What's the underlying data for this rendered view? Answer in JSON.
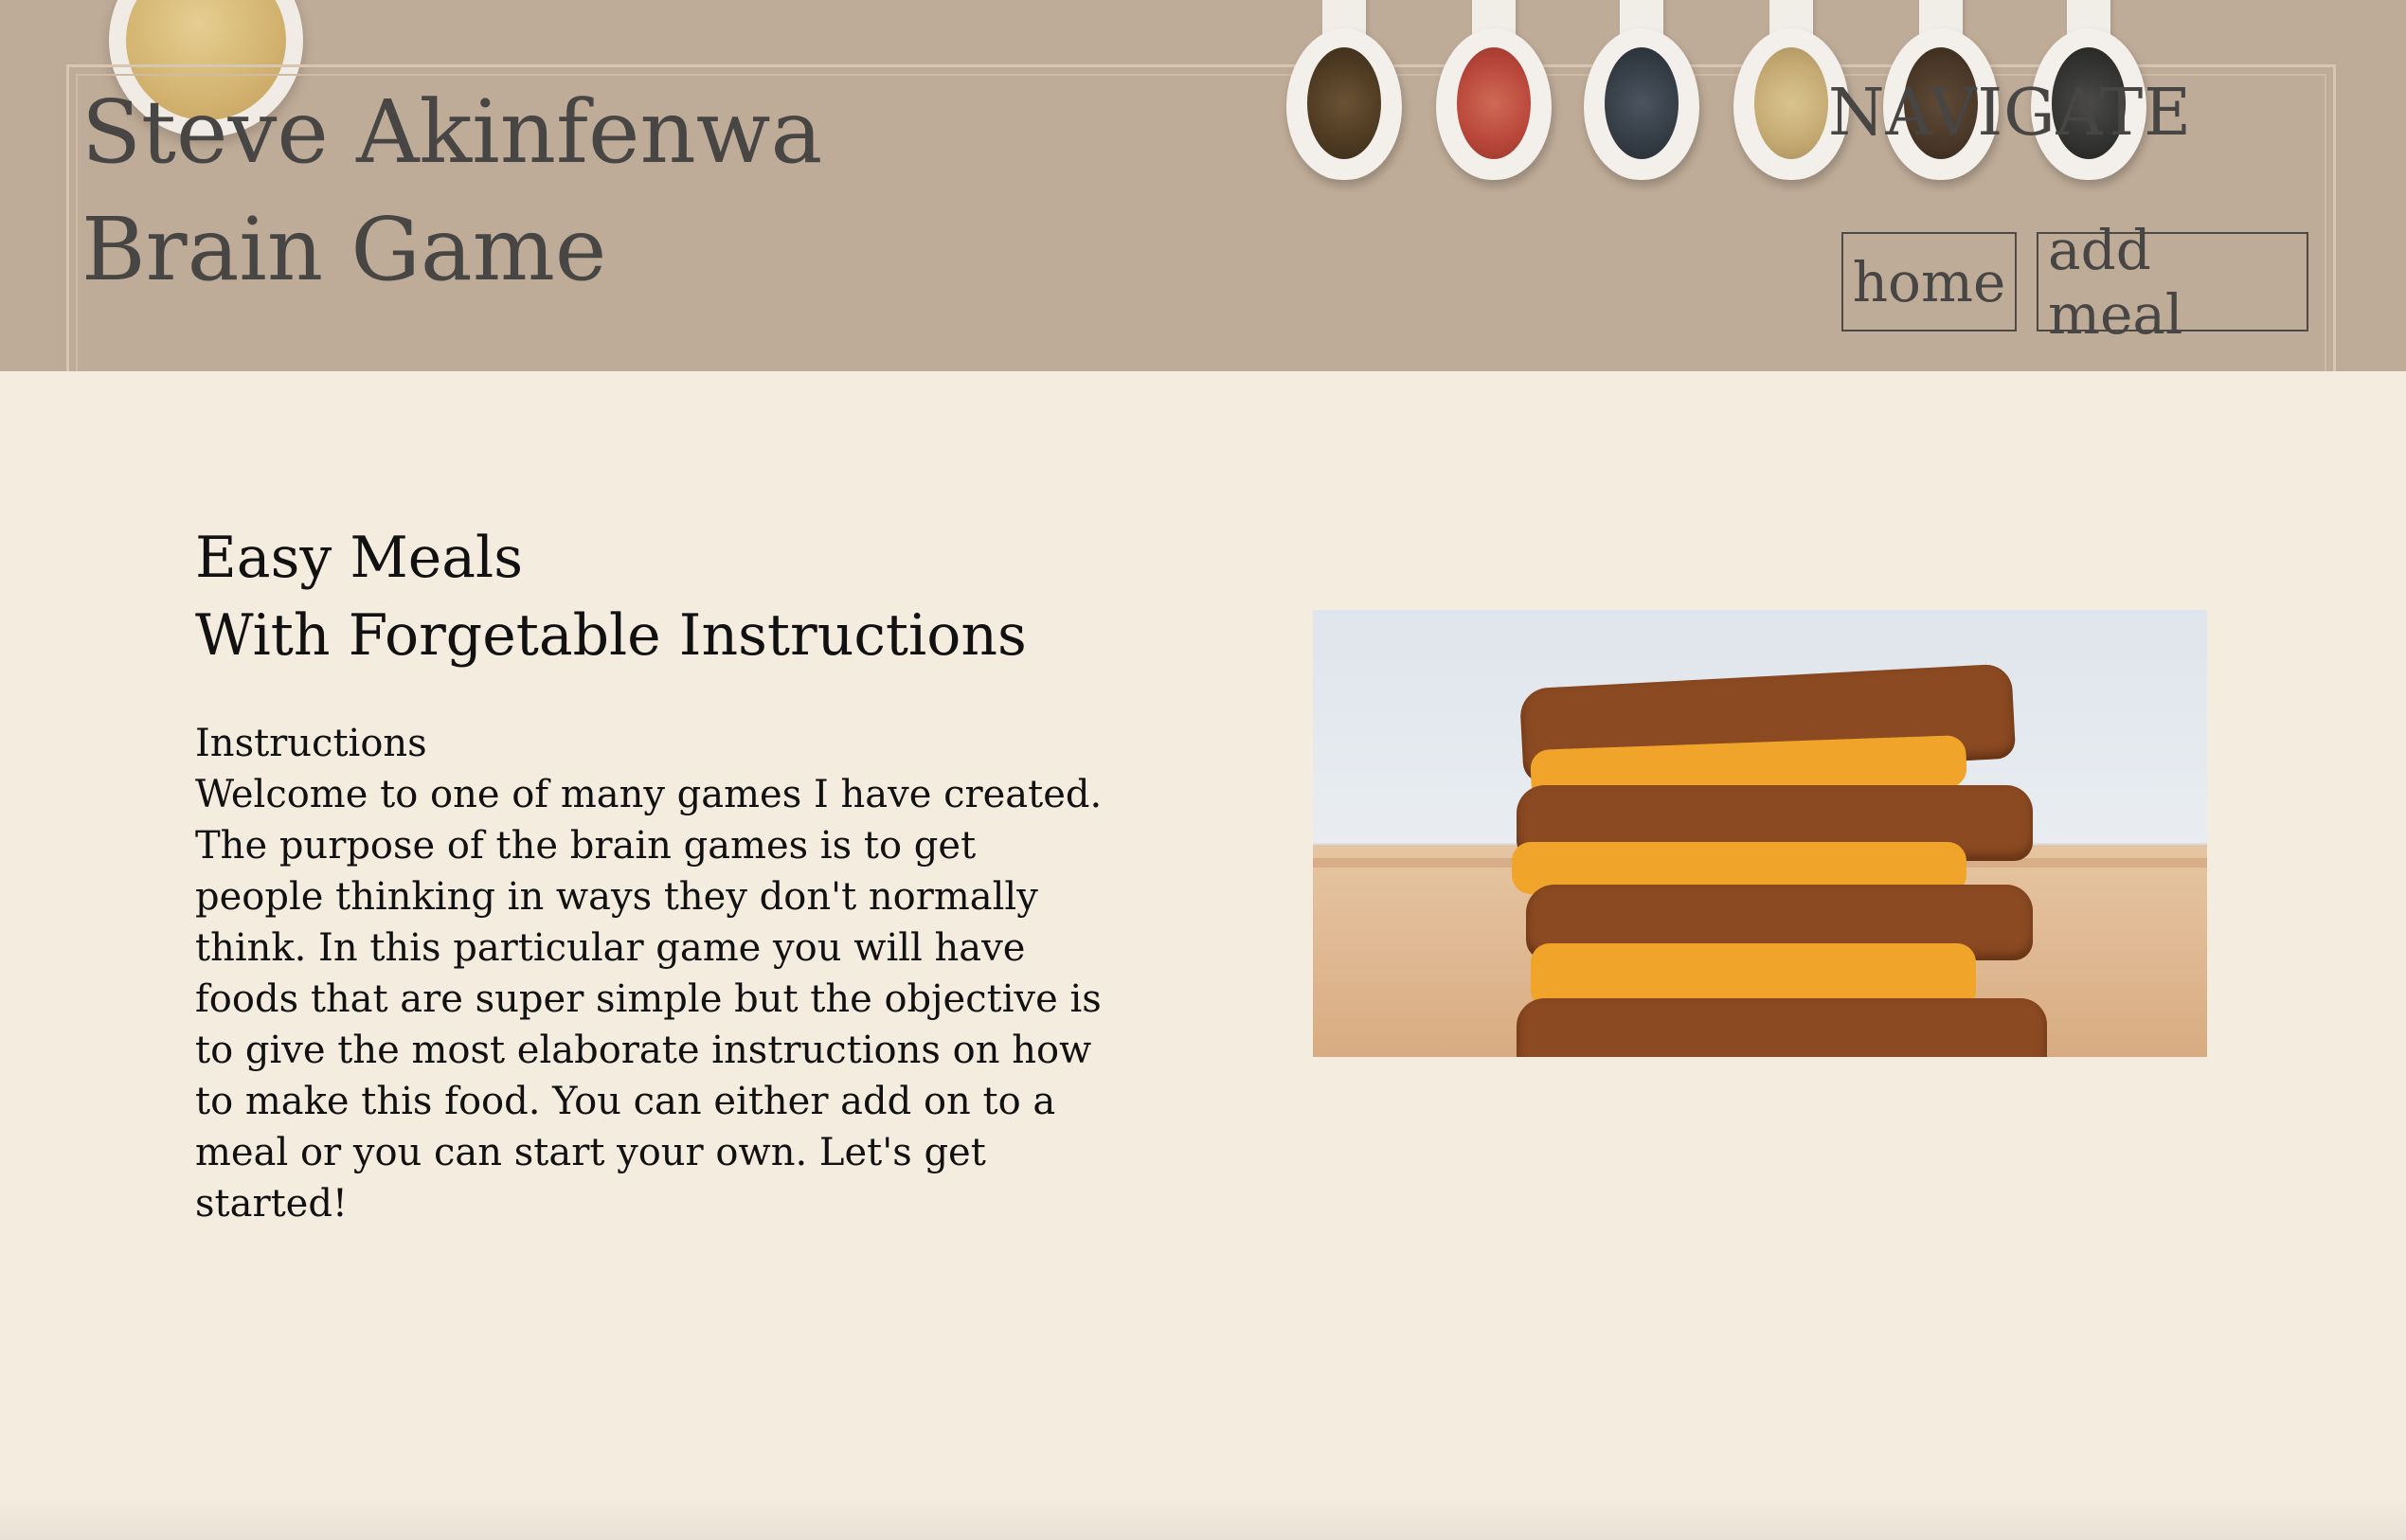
{
  "header": {
    "title_line1": "Steve Akinfenwa",
    "title_line2": "Brain Game",
    "nav_heading": "NAVIGATE",
    "nav_links": {
      "home": "home",
      "add_meal": "add meal"
    }
  },
  "main": {
    "title_line1": "Easy Meals",
    "title_line2": "With Forgetable Instructions",
    "instructions_heading": "Instructions",
    "instructions_text": "Welcome to one of many games I have created. The purpose of the brain games is to get people thinking in ways they don't normally think. In this particular game you will have foods that are super simple but the objective is to give the most elaborate instructions on how to make this food. You can either add on to a meal or you can start your own. Let's get started!"
  },
  "colors": {
    "header_bg": "#bfac98",
    "page_bg": "#f5ece0",
    "header_text": "#484644",
    "body_text": "#111111"
  },
  "icons": {
    "header_decoration": "spice-spoons",
    "food_image": "grilled-cheese-sandwich"
  }
}
